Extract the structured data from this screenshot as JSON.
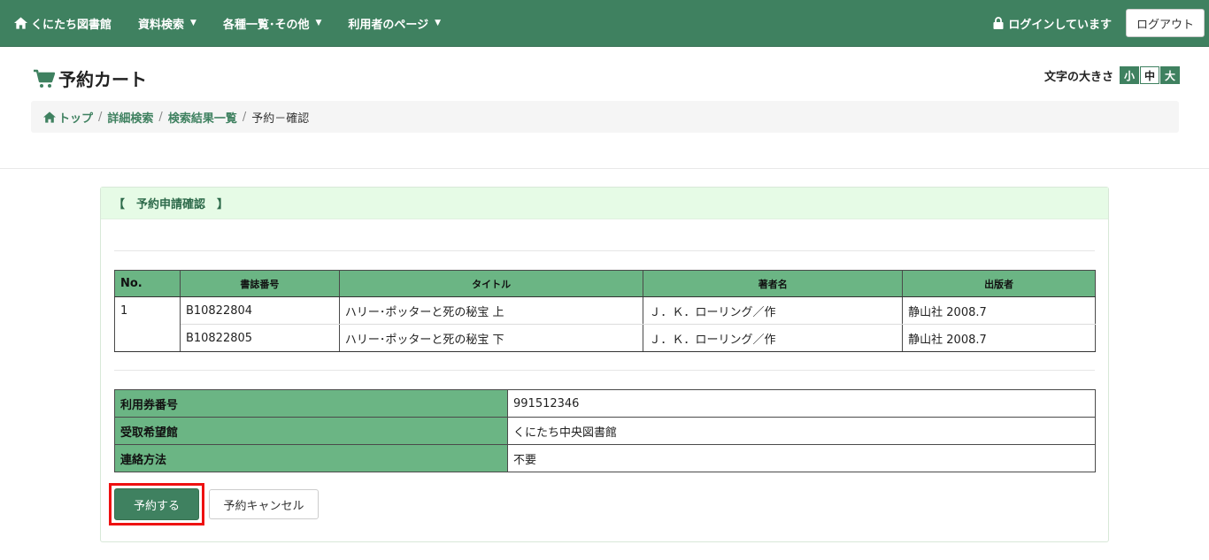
{
  "nav": {
    "brand": "くにたち図書館",
    "items": [
      {
        "label": "資料検索"
      },
      {
        "label": "各種一覧･その他"
      },
      {
        "label": "利用者のページ"
      }
    ],
    "login_status": "ログインしています",
    "logout_label": "ログアウト"
  },
  "header": {
    "title": "予約カート",
    "font_size_label": "文字の大きさ",
    "font_sizes": [
      "小",
      "中",
      "大"
    ]
  },
  "breadcrumb": {
    "items": [
      "トップ",
      "詳細検索",
      "検索結果一覧"
    ],
    "current": "予約－確認",
    "separator": "/"
  },
  "panel": {
    "heading": "【　予約申請確認　】",
    "items_table": {
      "headers": [
        "No.",
        "書誌番号",
        "タイトル",
        "著者名",
        "出版者"
      ],
      "rows": [
        {
          "no": "1",
          "bib": "B10822804",
          "title": "ハリー･ポッターと死の秘宝 上",
          "author": "Ｊ．Ｋ．ローリング／作",
          "publisher": "静山社 2008.7"
        },
        {
          "no": "",
          "bib": "B10822805",
          "title": "ハリー･ポッターと死の秘宝 下",
          "author": "Ｊ．Ｋ．ローリング／作",
          "publisher": "静山社 2008.7"
        }
      ]
    },
    "info_table": [
      {
        "label": "利用券番号",
        "value": "991512346"
      },
      {
        "label": "受取希望館",
        "value": "くにたち中央図書館"
      },
      {
        "label": "連絡方法",
        "value": "不要"
      }
    ],
    "submit_label": "予約する",
    "cancel_label": "予約キャンセル"
  },
  "colors": {
    "nav_bg": "#3f8160",
    "table_header": "#6bb584",
    "panel_heading_bg": "#e6fbe6",
    "highlight": "#e11111"
  }
}
